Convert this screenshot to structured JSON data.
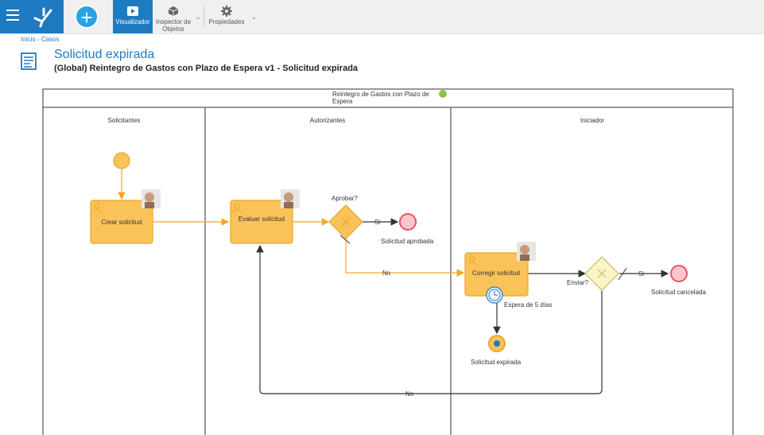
{
  "toolbar": {
    "visualizador": "Visualizador",
    "inspector_line1": "Inspector de",
    "inspector_line2": "Objetos",
    "propiedades": "Propiedades"
  },
  "breadcrumb": {
    "home": "Inicio",
    "separator": "›",
    "current": "Casos"
  },
  "page": {
    "title": "Solicitud expirada",
    "subtitle": "(Global) Reintegro de Gastos con Plazo de Espera v1 - Solicitud expirada"
  },
  "diagram": {
    "pool_title_line1": "Reintegro de Gastos con Plazo de",
    "pool_title_line2": "Espera",
    "lanes": [
      "Solicitantes",
      "Autorizantes",
      "Iniciador"
    ],
    "tasks": {
      "crear": "Crear solicitud",
      "evaluar": "Evaluar solicitud",
      "corregir": "Corregir solicitud"
    },
    "gateways": {
      "aprobar": "Aprobar?",
      "enviar": "Enviar?"
    },
    "events": {
      "aprobada": "Solicitud aprobada",
      "cancelada": "Solicitud cancelada",
      "expirada": "Solicitud expirada",
      "timer": "Espera de 5 días"
    },
    "flows": {
      "si1": "Si",
      "no1": "No",
      "si2": "Si",
      "no2": "No"
    }
  },
  "colors": {
    "brand": "#1f7bc1",
    "task_fill": "#f9c35a",
    "flow": "#f5a623",
    "end_event": "#e8555f",
    "pool_active": "#8bc34a"
  }
}
